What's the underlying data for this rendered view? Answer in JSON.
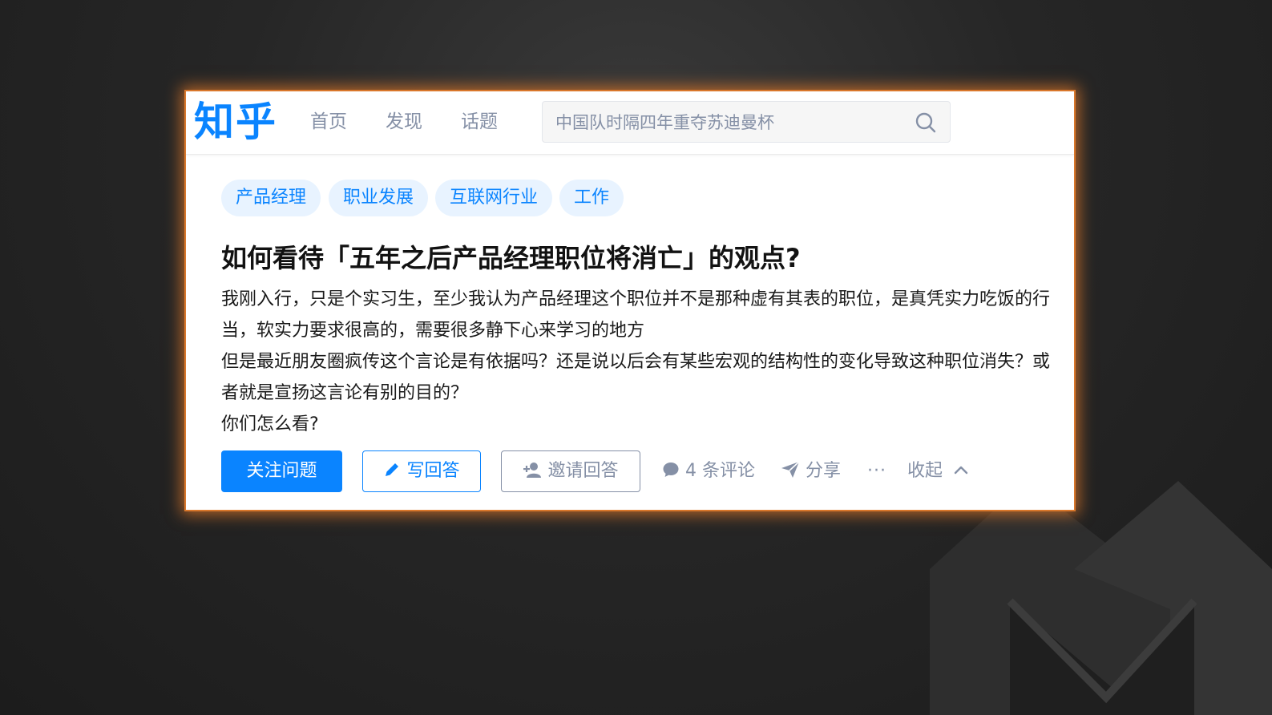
{
  "header": {
    "logo": "知乎",
    "nav": [
      "首页",
      "发现",
      "话题"
    ],
    "search_placeholder": "中国队时隔四年重夺苏迪曼杯"
  },
  "question": {
    "topics": [
      "产品经理",
      "职业发展",
      "互联网行业",
      "工作"
    ],
    "title": "如何看待「五年之后产品经理职位将消亡」的观点?",
    "paragraphs": [
      "我刚入行，只是个实习生，至少我认为产品经理这个职位并不是那种虚有其表的职位，是真凭实力吃饭的行当，软实力要求很高的，需要很多静下心来学习的地方",
      "但是最近朋友圈疯传这个言论是有依据吗？还是说以后会有某些宏观的结构性的变化导致这种职位消失？或者就是宣扬这言论有别的目的？",
      "你们怎么看?"
    ]
  },
  "actions": {
    "follow": "关注问题",
    "write": "写回答",
    "invite": "邀请回答",
    "comments": "4 条评论",
    "share": "分享",
    "more": "···",
    "collapse": "收起"
  },
  "colors": {
    "brand": "#0a84ff",
    "muted": "#8590a6",
    "tag_bg": "#e8f3ff",
    "frame_glow": "#d9772b"
  },
  "icons": [
    "search-icon",
    "pencil-icon",
    "add-user-icon",
    "comment-icon",
    "share-icon",
    "chevron-up-icon"
  ]
}
